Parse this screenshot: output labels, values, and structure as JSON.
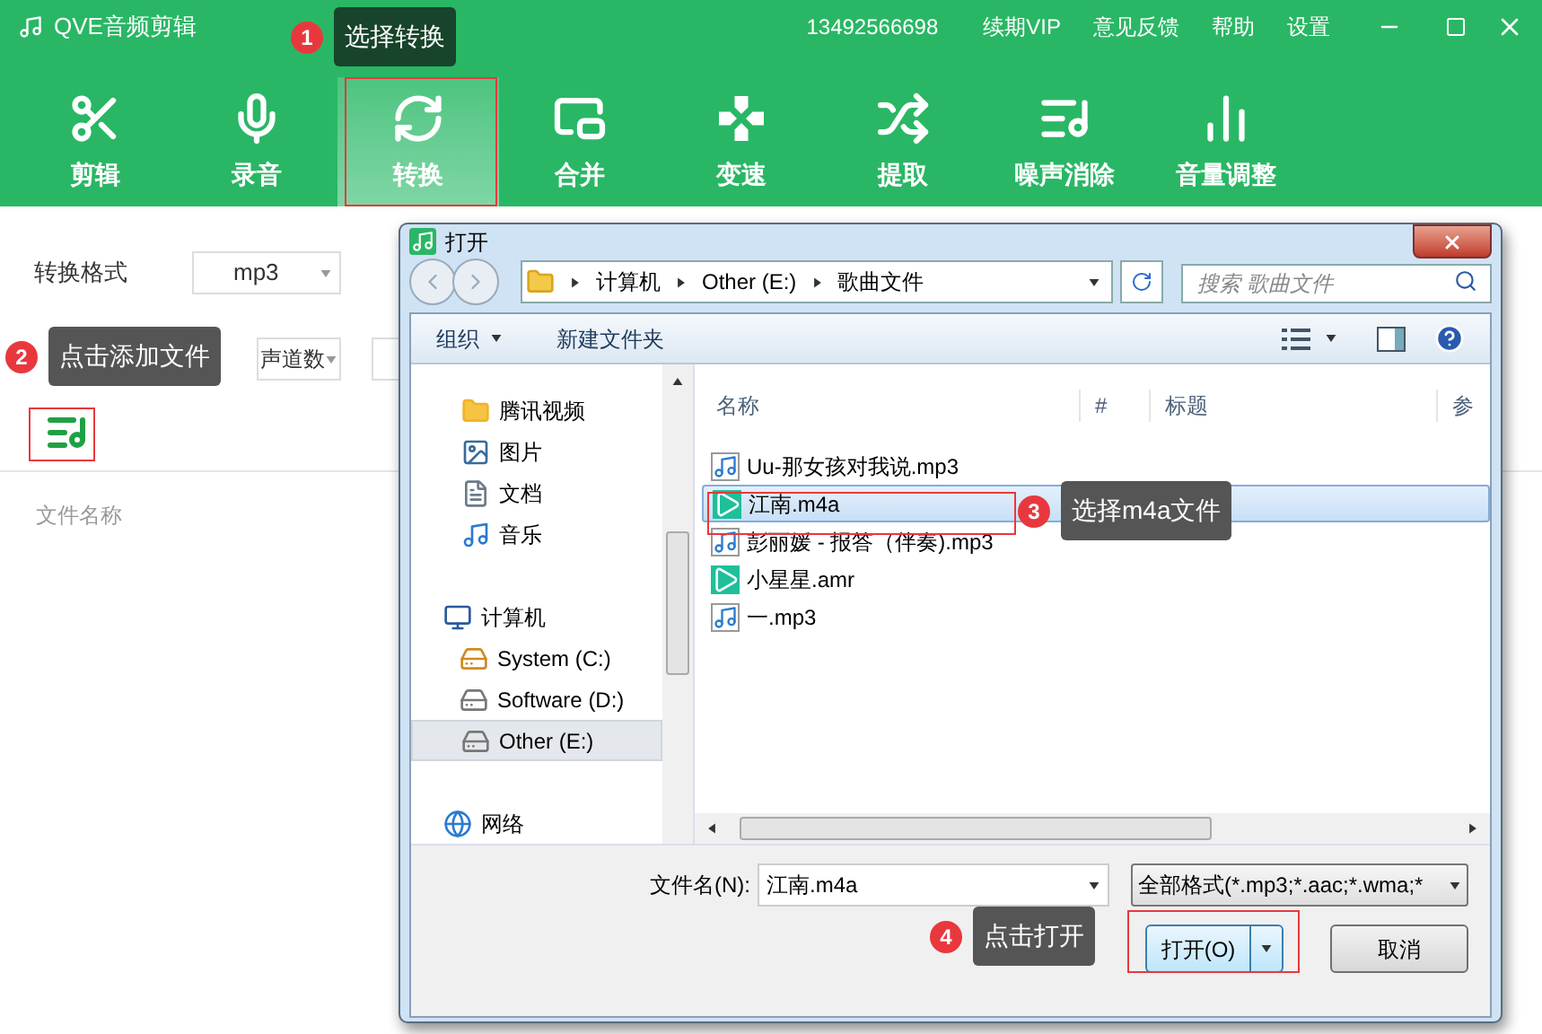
{
  "app": {
    "title": "QVE音频剪辑",
    "account": "13492566698",
    "links": [
      "续期VIP",
      "意见反馈",
      "帮助",
      "设置"
    ]
  },
  "tabs": [
    {
      "label": "剪辑",
      "selected": false
    },
    {
      "label": "录音",
      "selected": false
    },
    {
      "label": "转换",
      "selected": true
    },
    {
      "label": "合并",
      "selected": false
    },
    {
      "label": "变速",
      "selected": false
    },
    {
      "label": "提取",
      "selected": false
    },
    {
      "label": "噪声消除",
      "selected": false
    },
    {
      "label": "音量调整",
      "selected": false
    }
  ],
  "settings": {
    "format_label": "转换格式",
    "format_value": "mp3",
    "channel_value": "声道数"
  },
  "file_list": {
    "column": "文件名称"
  },
  "dialog": {
    "title": "打开",
    "breadcrumb": [
      "计算机",
      "Other (E:)",
      "歌曲文件"
    ],
    "search_placeholder": "搜索 歌曲文件",
    "toolbar": [
      "组织",
      "新建文件夹"
    ],
    "nav": [
      {
        "label": "腾讯视频",
        "kind": "video",
        "selected": false
      },
      {
        "label": "图片",
        "kind": "pictures",
        "selected": false
      },
      {
        "label": "文档",
        "kind": "documents",
        "selected": false
      },
      {
        "label": "音乐",
        "kind": "music",
        "selected": false
      },
      {
        "label": "计算机",
        "kind": "computer",
        "selected": false
      },
      {
        "label": "System (C:)",
        "kind": "system",
        "selected": false
      },
      {
        "label": "Software (D:)",
        "kind": "drive",
        "selected": false
      },
      {
        "label": "Other (E:)",
        "kind": "drive",
        "selected": true
      },
      {
        "label": "网络",
        "kind": "network",
        "selected": false
      }
    ],
    "columns": [
      "名称",
      "#",
      "标题",
      "参"
    ],
    "files": [
      {
        "name": "Uu-那女孩对我说.mp3",
        "kind": "mp3",
        "selected": false
      },
      {
        "name": "江南.m4a",
        "kind": "m4a",
        "selected": true
      },
      {
        "name": "彭丽媛 - 报答（伴奏).mp3",
        "kind": "mp3",
        "selected": false
      },
      {
        "name": "小星星.amr",
        "kind": "amr",
        "selected": false
      },
      {
        "name": "一.mp3",
        "kind": "mp3",
        "selected": false
      }
    ],
    "filename_label": "文件名(N):",
    "filename_value": "江南.m4a",
    "filter": "全部格式(*.mp3;*.aac;*.wma;*",
    "open_button": "打开(O)",
    "cancel_button": "取消"
  },
  "callouts": [
    {
      "number": "1",
      "text": "选择转换",
      "color": "#17442a"
    },
    {
      "number": "2",
      "text": "点击添加文件",
      "color": "#555555"
    },
    {
      "number": "3",
      "text": "选择m4a文件",
      "color": "#555555"
    },
    {
      "number": "4",
      "text": "点击打开",
      "color": "#555555"
    }
  ]
}
